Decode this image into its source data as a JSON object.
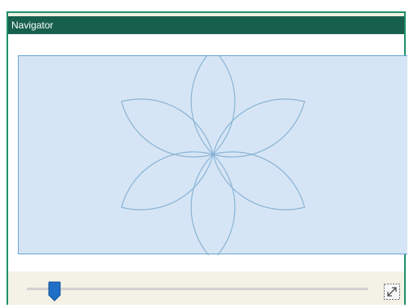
{
  "window": {
    "title": "Navigator"
  },
  "zoom": {
    "level_fraction": 0.08
  },
  "icons": {
    "fit": "fit-to-window-icon",
    "thumb": "slider-thumb-icon"
  },
  "colors": {
    "titlebar": "#17604d",
    "border": "#1e8f6a",
    "preview_bg": "#d6e5f5",
    "shape_stroke": "#8ab4d6",
    "thumb": "#1f6fc7"
  }
}
